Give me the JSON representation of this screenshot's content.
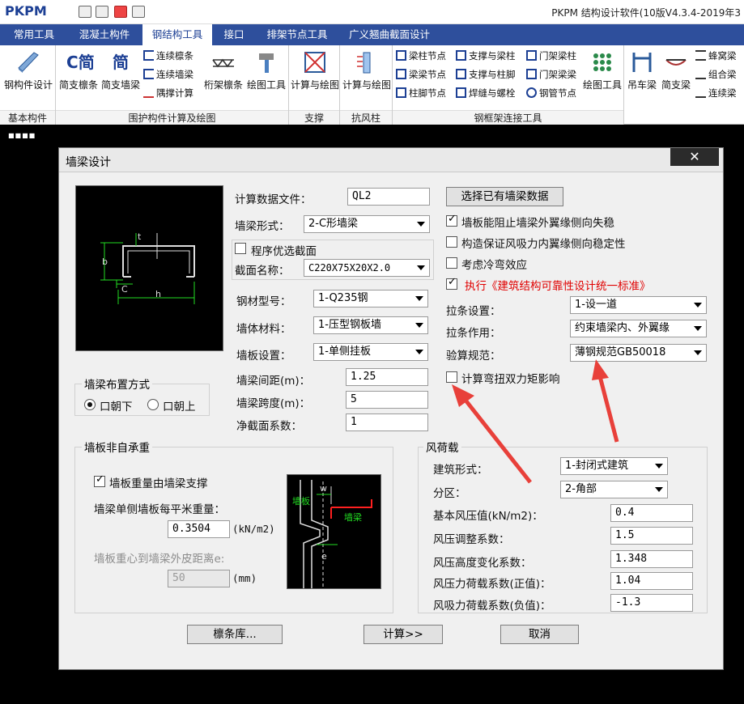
{
  "app": {
    "logo": "PKPM",
    "title": "PKPM 结构设计软件(10版V4.3.4-2019年3"
  },
  "menubar": [
    "常用工具",
    "混凝土构件",
    "钢结构工具",
    "接口",
    "排架节点工具",
    "广义翘曲截面设计"
  ],
  "ribbon": {
    "groups": [
      "基本构件",
      "围护构件计算及绘图",
      "支撑",
      "抗风柱",
      "钢框架连接工具"
    ],
    "big_buttons": [
      "钢构件设计",
      "简支檩条",
      "简支墙梁",
      "桁架檩条",
      "绘图工具",
      "计算与绘图",
      "计算与绘图",
      "绘图工具",
      "吊车梁",
      "简支梁"
    ],
    "small_buttons": [
      "连续檩条",
      "连续墙梁",
      "隅撑计算",
      "梁柱节点",
      "梁梁节点",
      "柱脚节点",
      "支撑与梁柱",
      "支撑与柱脚",
      "焊缝与螺栓",
      "门架梁柱",
      "门架梁梁",
      "钢管节点",
      "蜂窝梁",
      "组合梁",
      "连续梁"
    ],
    "big_icon_text": [
      "简",
      "简"
    ]
  },
  "dialog": {
    "title": "墙梁设计",
    "close": "✕",
    "section_diagram_labels": {
      "t": "t",
      "b": "b",
      "c": "C",
      "h": "h"
    },
    "fields": {
      "calc_file_label": "计算数据文件：",
      "calc_file_value": "QL2",
      "select_existing_button": "选择已有墙梁数据",
      "beam_form_label": "墙梁形式：",
      "beam_form_value": "2-C形墙梁",
      "optimize_label": "程序优选截面",
      "section_name_label": "截面名称：",
      "section_name_value": "C220X75X20X2.0",
      "steel_label": "钢材型号：",
      "steel_value": "1-Q235钢",
      "wall_material_label": "墙体材料：",
      "wall_material_value": "1-压型钢板墙",
      "panel_setting_label": "墙板设置：",
      "panel_setting_value": "1-单侧挂板",
      "spacing_label": "墙梁间距(m)：",
      "spacing_value": "1.25",
      "span_label": "墙梁跨度(m)：",
      "span_value": "5",
      "net_section_label": "净截面系数：",
      "net_section_value": "1"
    },
    "layout_group": {
      "title": "墙梁布置方式",
      "option_down": "口朝下",
      "option_up": "口朝上",
      "selected": "口朝下"
    },
    "right_checks": [
      {
        "label": "墙板能阻止墙梁外翼缘侧向失稳",
        "checked": true
      },
      {
        "label": "构造保证风吸力内翼缘侧向稳定性",
        "checked": false
      },
      {
        "label": "考虑冷弯效应",
        "checked": false
      },
      {
        "label": "执行《建筑结构可靠性设计统一标准》",
        "checked": true
      }
    ],
    "right_fields": {
      "brace_setting_label": "拉条设置：",
      "brace_setting_value": "1-设一道",
      "brace_effect_label": "拉条作用：",
      "brace_effect_value": "约束墙梁内、外翼缘",
      "code_label": "验算规范：",
      "code_value": "薄钢规范GB50018",
      "bimoment_label": "计算弯扭双力矩影响",
      "bimoment_checked": false
    },
    "panel_group": {
      "title": "墙板非自承重",
      "support_label": "墙板重量由墙梁支撑",
      "support_checked": true,
      "weight_label": "墙梁单侧墙板每平米重量：",
      "weight_value": "0.3504",
      "weight_unit": "(kN/m2)",
      "eccentric_label": "墙板重心到墙梁外皮距离e:",
      "eccentric_value": "50",
      "eccentric_unit": "(mm)",
      "diagram_labels": {
        "w": "w",
        "panel": "墙板",
        "beam": "墙梁",
        "e": "e"
      }
    },
    "wind_group": {
      "title": "风荷载",
      "building_form_label": "建筑形式：",
      "building_form_value": "1-封闭式建筑",
      "zone_label": "分区：",
      "zone_value": "2-角部",
      "basic_pressure_label": "基本风压值(kN/m2)：",
      "basic_pressure_value": "0.4",
      "adjust_label": "风压调整系数：",
      "adjust_value": "1.5",
      "height_label": "风压高度变化系数：",
      "height_value": "1.348",
      "positive_label": "风压力荷载系数(正值)：",
      "positive_value": "1.04",
      "negative_label": "风吸力荷载系数(负值)：",
      "negative_value": "-1.3"
    },
    "buttons": {
      "library": "檩条库...",
      "calculate": "计算>>",
      "cancel": "取消"
    }
  },
  "colors": {
    "menubar": "#2e4f9c",
    "annotation_arrow": "#e8403a",
    "drawing_green": "#22dd22",
    "drawing_red": "#ff2020",
    "red_text": "#e00000"
  }
}
